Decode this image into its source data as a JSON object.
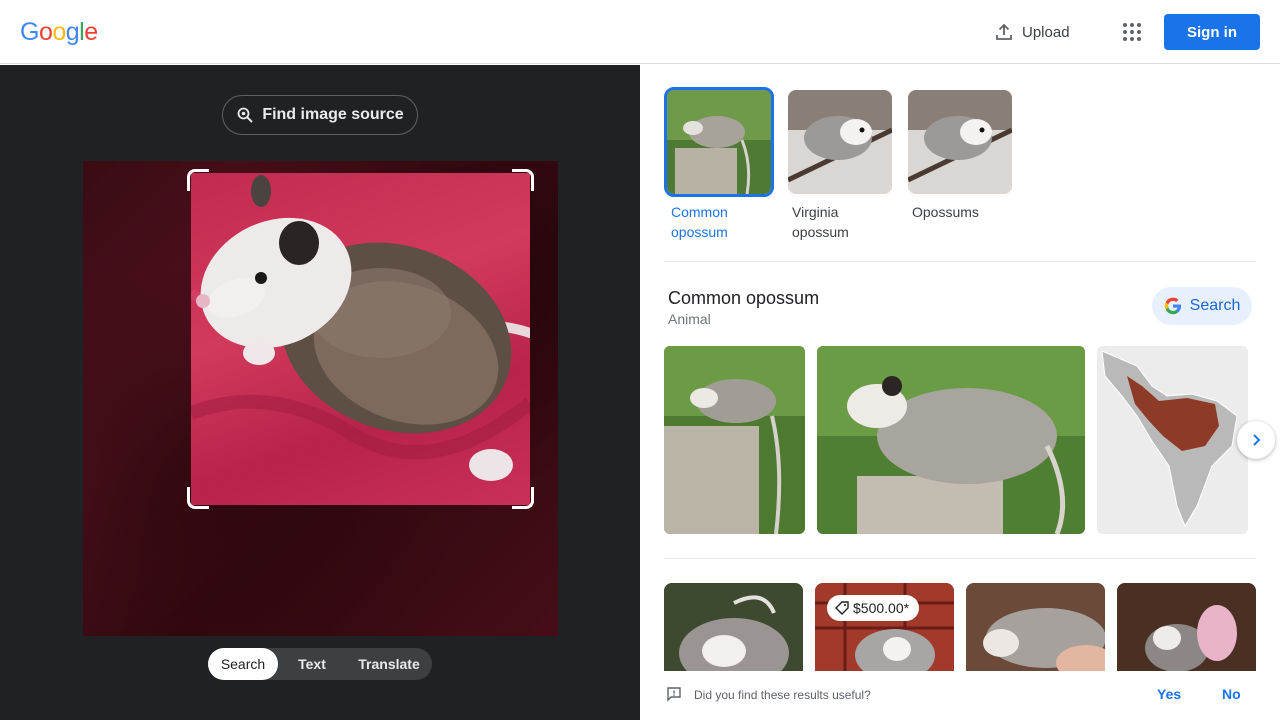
{
  "header": {
    "logo_letters": [
      {
        "char": "G",
        "color": "#4285F4"
      },
      {
        "char": "o",
        "color": "#EA4335"
      },
      {
        "char": "o",
        "color": "#FBBC05"
      },
      {
        "char": "g",
        "color": "#4285F4"
      },
      {
        "char": "l",
        "color": "#34A853"
      },
      {
        "char": "e",
        "color": "#EA4335"
      }
    ],
    "upload_label": "Upload",
    "upload_icon": "upload-icon",
    "apps_icon": "apps-grid-icon",
    "signin_label": "Sign in"
  },
  "left": {
    "find_source_label": "Find image source",
    "find_source_icon": "lens-search-icon",
    "tabs": [
      {
        "label": "Search",
        "active": true
      },
      {
        "label": "Text",
        "active": false
      },
      {
        "label": "Translate",
        "active": false
      }
    ]
  },
  "right": {
    "entities": [
      {
        "label": "Common opossum",
        "active": true
      },
      {
        "label": "Virginia opossum",
        "active": false
      },
      {
        "label": "Opossums",
        "active": false
      }
    ],
    "knowledge_panel": {
      "title": "Common opossum",
      "subtitle": "Animal",
      "search_label": "Search",
      "next_icon": "chevron-right-icon"
    },
    "results": [
      {
        "price": ""
      },
      {
        "price": "$500.00*"
      },
      {
        "price": ""
      },
      {
        "price": ""
      }
    ],
    "feedback": {
      "question": "Did you find these results useful?",
      "yes_label": "Yes",
      "no_label": "No"
    }
  },
  "colors": {
    "accent": "#1a73e8",
    "dark_panel": "#202124",
    "chip_bg": "#e8f0fe"
  }
}
